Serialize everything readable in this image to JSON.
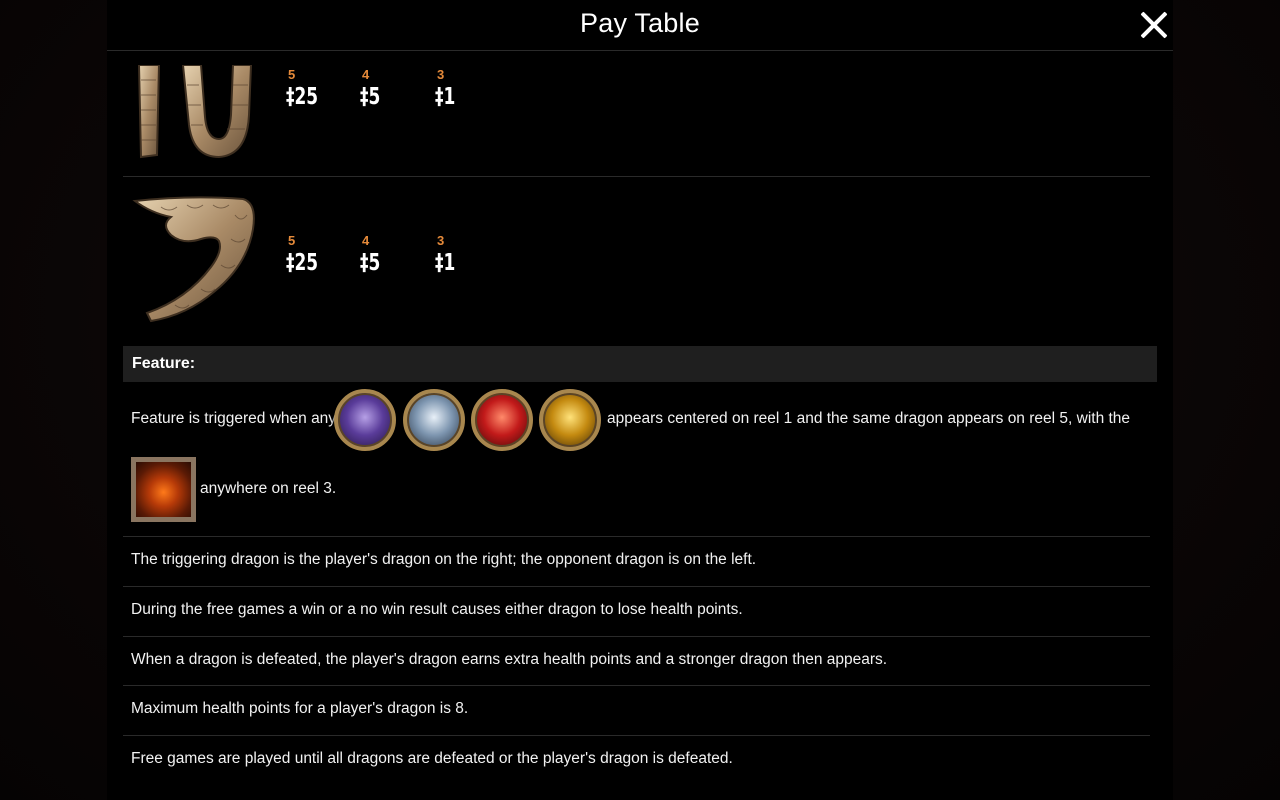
{
  "header": {
    "title": "Pay Table"
  },
  "symbols": [
    {
      "icon": "ten-symbol-icon",
      "pays": [
        {
          "count": "5",
          "amount": "‡25"
        },
        {
          "count": "4",
          "amount": "‡5"
        },
        {
          "count": "3",
          "amount": "‡1"
        }
      ]
    },
    {
      "icon": "nine-symbol-icon",
      "pays": [
        {
          "count": "5",
          "amount": "‡25"
        },
        {
          "count": "4",
          "amount": "‡5"
        },
        {
          "count": "3",
          "amount": "‡1"
        }
      ]
    }
  ],
  "feature": {
    "heading": "Feature:",
    "text_before_icons": "Feature is triggered when any",
    "text_after_icons": "appears centered on reel 1 and the same dragon appears on reel 5, with the",
    "text_after_scatter": "anywhere on reel 3.",
    "dragon_icons": [
      "purple-dragon-icon",
      "silver-dragon-icon",
      "red-dragon-icon",
      "gold-dragon-icon"
    ],
    "scatter_icon": "fire-dragon-scatter-icon"
  },
  "rules": [
    "The triggering dragon is the player's dragon on the right; the opponent dragon is on the left.",
    "During the free games a win or a no win result causes either dragon to lose health points.",
    "When a dragon is defeated, the player's dragon earns extra health points and a stronger dragon then appears.",
    "Maximum health points for a player's dragon is 8.",
    "Free games are played until all dragons are defeated or the player's dragon is defeated."
  ],
  "colors": {
    "count_label": "#e58a3a",
    "feature_bar": "#1f1f1f",
    "divider": "#2a2a2a"
  }
}
